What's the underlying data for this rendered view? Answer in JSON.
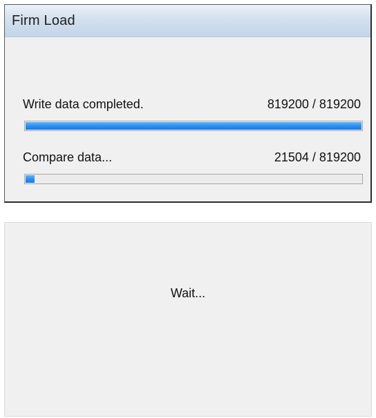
{
  "window": {
    "title": "Firm Load"
  },
  "rows": [
    {
      "label": "Write data completed.",
      "count": "819200 / 819200",
      "progress": 1.0
    },
    {
      "label": "Compare data...",
      "count": "21504 / 819200",
      "progress": 0.02625
    }
  ],
  "wait_dialog": {
    "message": "Wait..."
  },
  "colors": {
    "progress_fill": "#2d8ff0",
    "titlebar": "#c3d5e8",
    "window_bg": "#f0f0f0"
  }
}
